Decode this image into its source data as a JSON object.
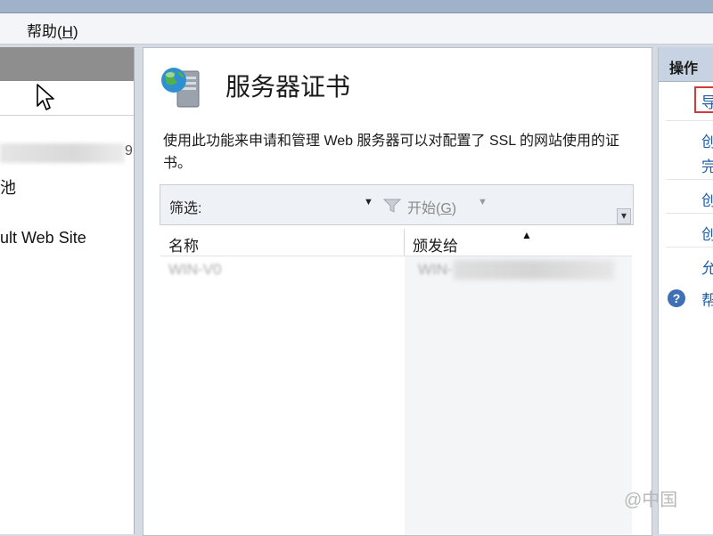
{
  "menubar": {
    "help_prefix": "帮助(",
    "help_key": "H",
    "help_suffix": ")"
  },
  "left_panel": {
    "partial_digit": "9",
    "items": [
      {
        "label": "池"
      },
      {
        "label": "ult Web Site"
      }
    ]
  },
  "feature": {
    "title": "服务器证书",
    "icon": "server-globe-icon",
    "description": "使用此功能来申请和管理 Web 服务器可以对配置了 SSL 的网站使用的证书。"
  },
  "filter": {
    "label": "筛选:",
    "value": "",
    "start_prefix": "开始(",
    "start_key": "G",
    "start_suffix": ")"
  },
  "grid": {
    "columns": [
      "名称",
      "颁发给"
    ],
    "sorted_column": "颁发给",
    "rows": [
      {
        "name": "WIN-V0",
        "issued_to": "WIN-"
      }
    ]
  },
  "actions": {
    "title": "操作",
    "items": [
      {
        "label": "导",
        "highlighted": true
      },
      {
        "label": "创"
      },
      {
        "label": "完"
      },
      {
        "label": "创"
      },
      {
        "label": "创"
      },
      {
        "label": "允"
      },
      {
        "label": "帮",
        "icon": "help-icon"
      }
    ]
  },
  "watermark": "@中国",
  "colors": {
    "link": "#1f5fa8",
    "highlight": "#d23b3b",
    "header": "#c7d3e2"
  }
}
